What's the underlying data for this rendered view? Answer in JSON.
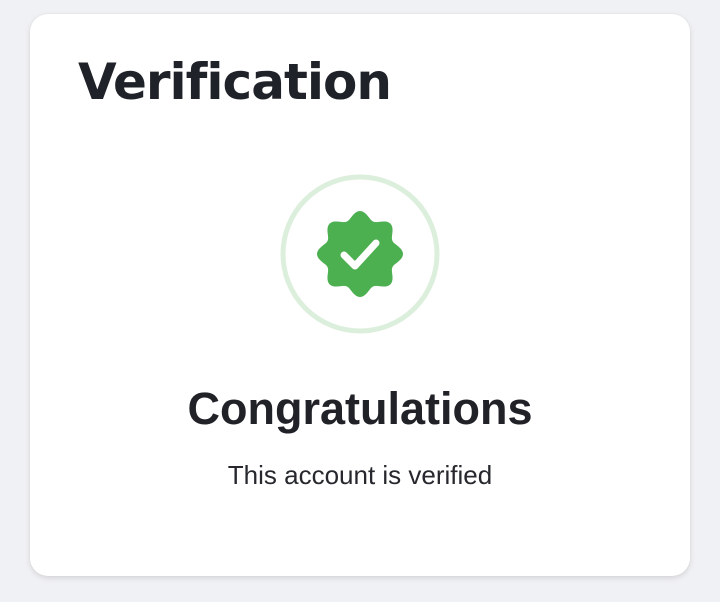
{
  "card": {
    "title": "Verification",
    "heading": "Congratulations",
    "message": "This account is verified"
  },
  "badge": {
    "icon": "verified-badge-icon",
    "check_icon": "checkmark-icon",
    "badge_color": "#4caf50",
    "ring_color": "#dcefdc",
    "check_color": "#ffffff"
  }
}
